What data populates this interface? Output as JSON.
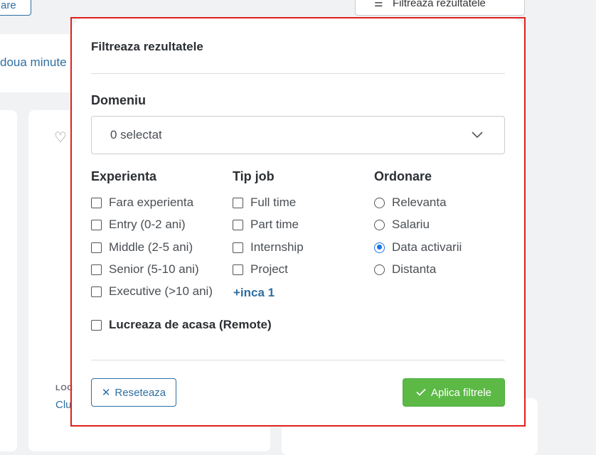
{
  "background": {
    "left_button_label": "are",
    "right_button_label": "Filtreaza rezultatele",
    "banner_text": "doua minute",
    "card_location_label": "LOC",
    "card_location_value": "Clu"
  },
  "modal": {
    "title": "Filtreaza rezultatele",
    "domain": {
      "label": "Domeniu",
      "selected_text": "0 selectat"
    },
    "experience": {
      "label": "Experienta",
      "options": [
        {
          "label": "Fara experienta",
          "checked": false
        },
        {
          "label": "Entry (0-2 ani)",
          "checked": false
        },
        {
          "label": "Middle (2-5 ani)",
          "checked": false
        },
        {
          "label": "Senior (5-10 ani)",
          "checked": false
        },
        {
          "label": "Executive (>10 ani)",
          "checked": false
        }
      ]
    },
    "job_type": {
      "label": "Tip job",
      "options": [
        {
          "label": "Full time",
          "checked": false
        },
        {
          "label": "Part time",
          "checked": false
        },
        {
          "label": "Internship",
          "checked": false
        },
        {
          "label": "Project",
          "checked": false
        }
      ],
      "more_link": "+inca 1"
    },
    "ordering": {
      "label": "Ordonare",
      "options": [
        {
          "label": "Relevanta",
          "selected": false
        },
        {
          "label": "Salariu",
          "selected": false
        },
        {
          "label": "Data activarii",
          "selected": true
        },
        {
          "label": "Distanta",
          "selected": false
        }
      ]
    },
    "remote": {
      "label": "Lucreaza de acasa (Remote)",
      "checked": false
    },
    "reset_button": "Reseteaza",
    "apply_button": "Aplica filtrele"
  },
  "colors": {
    "accent": "#2f6fa3",
    "apply_green": "#5cb946",
    "radio_selected": "#1a73e8",
    "highlight_border": "#e0211c"
  }
}
